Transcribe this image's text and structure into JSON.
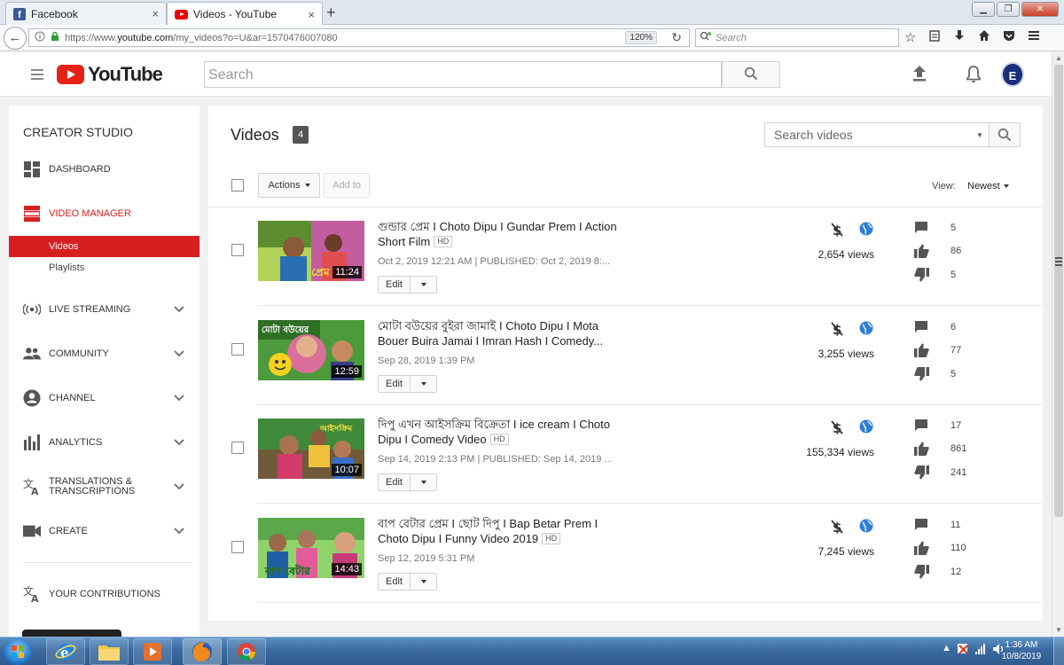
{
  "browser": {
    "tabs": [
      {
        "title": "Facebook",
        "icon": "facebook-icon"
      },
      {
        "title": "Videos - YouTube",
        "icon": "youtube-icon"
      }
    ],
    "url_prefix": "https://www.",
    "url_host": "youtube.com",
    "url_path": "/my_videos?o=U&ar=1570476007080",
    "zoom": "120%",
    "search_placeholder": "Search",
    "close_glyph": "×",
    "new_tab_glyph": "+"
  },
  "youtube": {
    "logo_text": "YouTube",
    "search_placeholder": "Search",
    "avatar_letter": "E"
  },
  "sidebar": {
    "title": "CREATOR STUDIO",
    "items": [
      {
        "label": "DASHBOARD",
        "icon": "dashboard-icon"
      },
      {
        "label": "VIDEO MANAGER",
        "icon": "video-manager-icon"
      },
      {
        "label": "LIVE STREAMING",
        "icon": "live-streaming-icon"
      },
      {
        "label": "COMMUNITY",
        "icon": "community-icon"
      },
      {
        "label": "CHANNEL",
        "icon": "channel-icon"
      },
      {
        "label": "ANALYTICS",
        "icon": "analytics-icon"
      },
      {
        "label": "TRANSLATIONS & TRANSCRIPTIONS",
        "icon": "translate-icon"
      },
      {
        "label": "CREATE",
        "icon": "create-icon"
      },
      {
        "label": "YOUR CONTRIBUTIONS",
        "icon": "translate-icon"
      }
    ],
    "sub_items": [
      {
        "label": "Videos"
      },
      {
        "label": "Playlists"
      }
    ]
  },
  "main": {
    "title": "Videos",
    "count": "4",
    "search_placeholder": "Search videos",
    "actions_label": "Actions",
    "add_to_label": "Add to",
    "view_label": "View:",
    "view_value": "Newest",
    "edit_label": "Edit",
    "videos": [
      {
        "title": "গুন্ডার প্রেম I Choto Dipu I Gundar Prem I Action Short Film",
        "hd": "HD",
        "date": "Oct 2, 2019 12:21 AM | PUBLISHED: Oct 2, 2019 8:...",
        "duration": "11:24",
        "views": "2,654 views",
        "comments": "5",
        "likes": "86",
        "dislikes": "5"
      },
      {
        "title": "মোটা বউয়ের বুইরা জামাই I Choto Dipu I Mota Bouer Buira Jamai I Imran Hash I Comedy...",
        "hd": "",
        "date": "Sep 28, 2019 1:39 PM",
        "duration": "12:59",
        "views": "3,255 views",
        "comments": "6",
        "likes": "77",
        "dislikes": "5"
      },
      {
        "title": "দিপু এখন আইসক্রিম বিক্রেতা I ice cream I Choto Dipu I Comedy Video",
        "hd": "HD",
        "date": "Sep 14, 2019 2:13 PM | PUBLISHED: Sep 14, 2019 ...",
        "duration": "10:07",
        "views": "155,334 views",
        "comments": "17",
        "likes": "861",
        "dislikes": "241"
      },
      {
        "title": "বাপ বেটার প্রেম I ছোট দিপু I Bap Betar Prem I Choto Dipu I Funny Video 2019",
        "hd": "HD",
        "date": "Sep 12, 2019 5:31 PM",
        "duration": "14:43",
        "views": "7,245 views",
        "comments": "11",
        "likes": "110",
        "dislikes": "12"
      }
    ]
  },
  "taskbar": {
    "time": "1:36 AM",
    "date": "10/8/2019"
  },
  "colors": {
    "accent_red": "#d71f1f",
    "youtube_red": "#e62117",
    "globe_blue": "#2f7ed8"
  }
}
